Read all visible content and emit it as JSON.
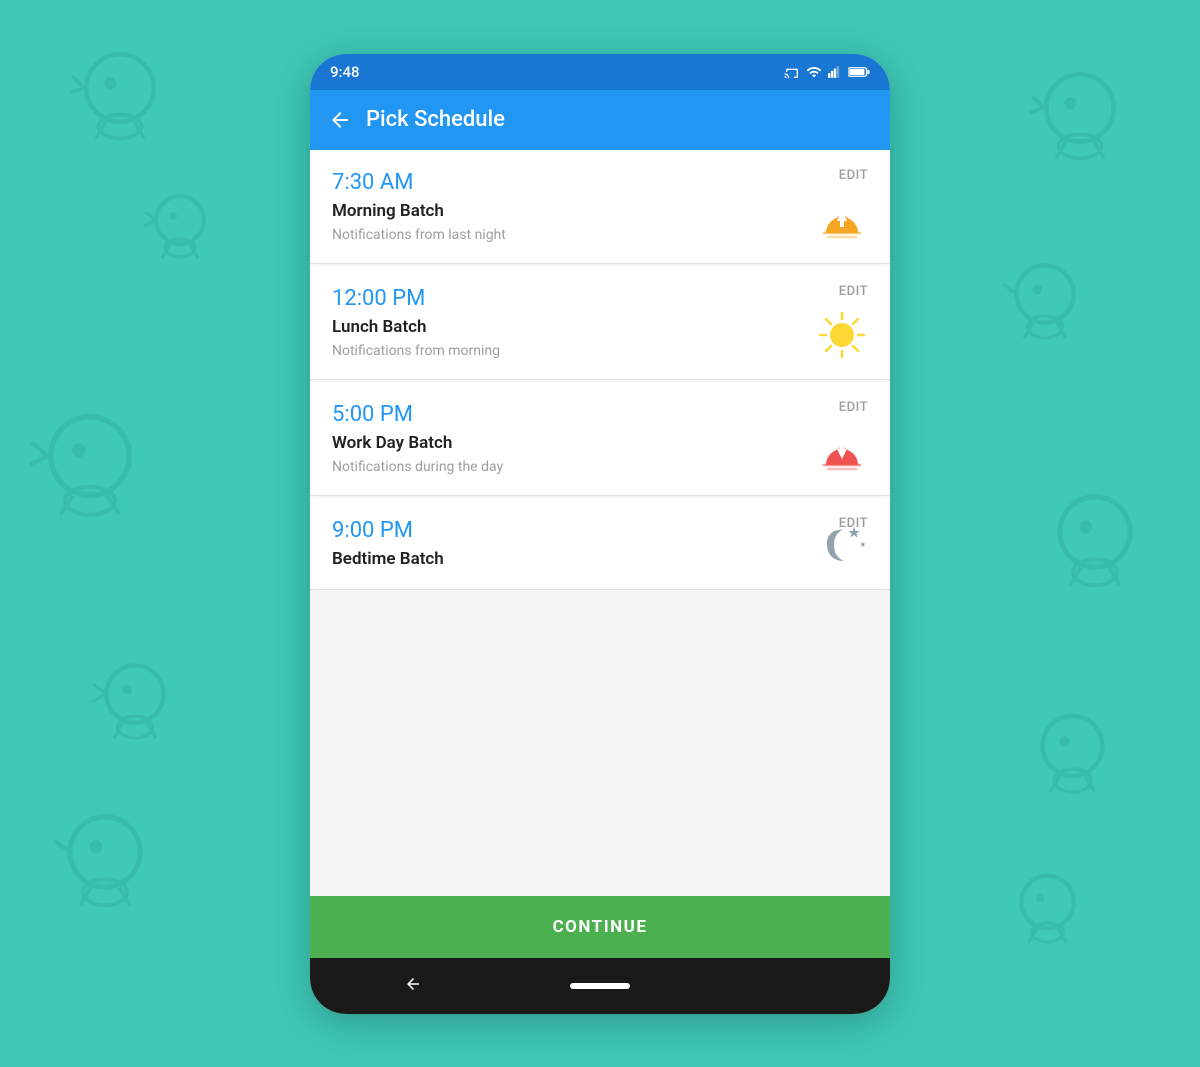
{
  "statusBar": {
    "time": "9:48"
  },
  "appBar": {
    "title": "Pick Schedule",
    "backLabel": "←"
  },
  "schedules": [
    {
      "id": "morning",
      "time": "7:30 AM",
      "title": "Morning Batch",
      "subtitle": "Notifications from last night",
      "iconType": "sunrise",
      "editLabel": "EDIT"
    },
    {
      "id": "lunch",
      "time": "12:00 PM",
      "title": "Lunch Batch",
      "subtitle": "Notifications from morning",
      "iconType": "noon",
      "editLabel": "EDIT"
    },
    {
      "id": "evening",
      "time": "5:00 PM",
      "title": "Work Day Batch",
      "subtitle": "Notifications during the day",
      "iconType": "sunset",
      "editLabel": "EDIT"
    },
    {
      "id": "night",
      "time": "9:00 PM",
      "title": "Bedtime Batch",
      "subtitle": "",
      "iconType": "moon",
      "editLabel": "EDIT"
    }
  ],
  "continueBtn": {
    "label": "CONTINUE"
  },
  "colors": {
    "appBar": "#2196f3",
    "statusBar": "#1976d2",
    "timeColor": "#2196f3",
    "continueBtn": "#4caf50",
    "sunriseSun": "#f5a623",
    "noonSun": "#fdd835",
    "sunsetSun": "#ef5350",
    "editText": "#9e9e9e"
  }
}
